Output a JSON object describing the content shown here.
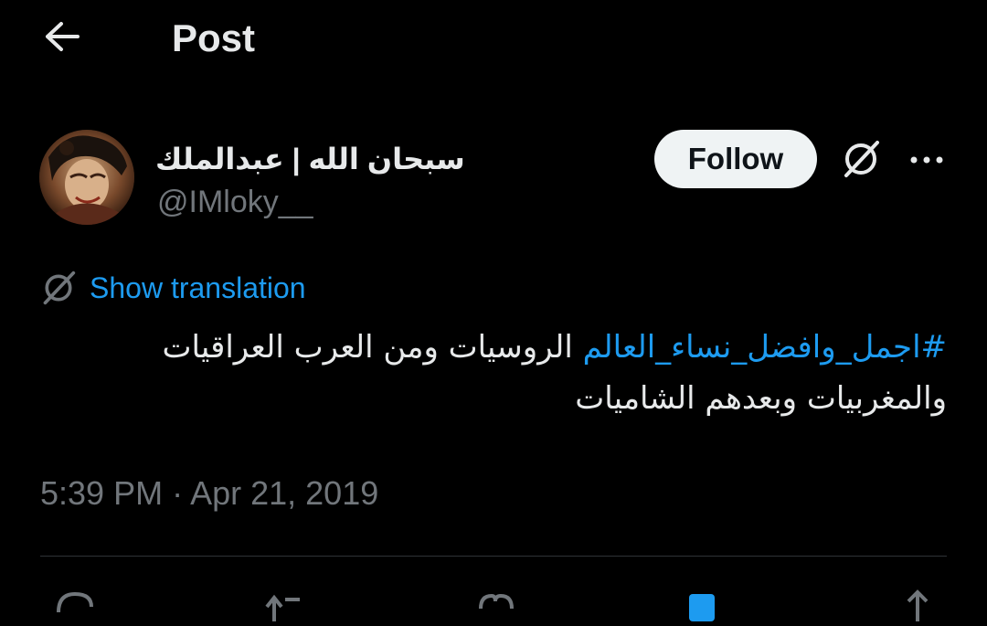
{
  "header": {
    "back_icon": "arrow-left-icon",
    "title": "Post"
  },
  "author": {
    "display_name": "سبحان الله | عبدالملك",
    "handle": "@IMloky__",
    "follow_label": "Follow",
    "grok_icon": "grok-icon",
    "more_icon": "more-horizontal-icon"
  },
  "translation": {
    "icon": "translate-icon",
    "label": "Show translation"
  },
  "tweet": {
    "hashtag": "#اجمل_وافضل_نساء_العالم",
    "text": " الروسيات ومن العرب العراقيات والمغربيات وبعدهم الشاميات"
  },
  "meta": {
    "timestamp": "5:39 PM · Apr 21, 2019"
  },
  "actions": [
    {
      "icon": "reply-icon"
    },
    {
      "icon": "repost-icon"
    },
    {
      "icon": "like-icon"
    },
    {
      "icon": "bookmark-icon"
    },
    {
      "icon": "share-icon"
    }
  ],
  "colors": {
    "background": "#000000",
    "text_primary": "#e7e9ea",
    "text_secondary": "#71767b",
    "accent": "#1d9bf0",
    "follow_bg": "#eff3f4",
    "divider": "#2f3336"
  }
}
